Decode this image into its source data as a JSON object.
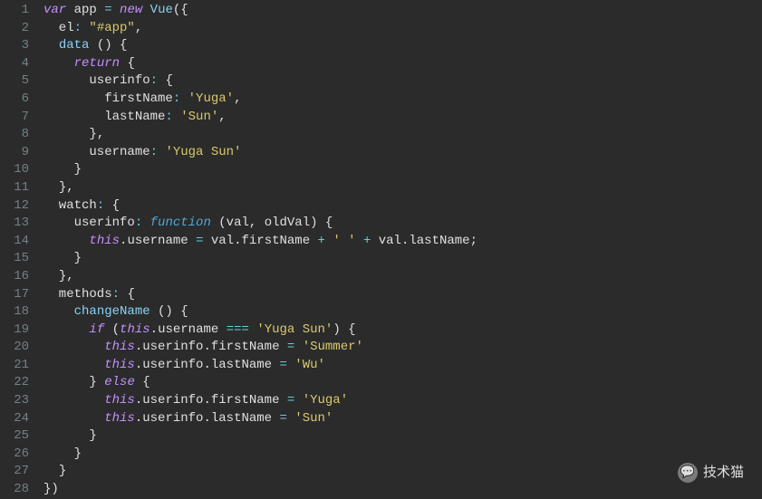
{
  "watermark": {
    "text": "技术猫",
    "icon": "💬"
  },
  "lines": {
    "count": 28,
    "tokens": [
      [
        [
          "kw",
          "var"
        ],
        [
          "id",
          " app "
        ],
        [
          "op",
          "="
        ],
        [
          "id",
          " "
        ],
        [
          "new",
          "new"
        ],
        [
          "id",
          " "
        ],
        [
          "def",
          "Vue"
        ],
        [
          "punc",
          "({"
        ]
      ],
      [
        [
          "id",
          "  el"
        ],
        [
          "op",
          ":"
        ],
        [
          "id",
          " "
        ],
        [
          "str",
          "\"#app\""
        ],
        [
          "punc",
          ","
        ]
      ],
      [
        [
          "id",
          "  "
        ],
        [
          "def",
          "data"
        ],
        [
          "id",
          " "
        ],
        [
          "punc",
          "() {"
        ]
      ],
      [
        [
          "id",
          "    "
        ],
        [
          "kw2",
          "return"
        ],
        [
          "id",
          " "
        ],
        [
          "punc",
          "{"
        ]
      ],
      [
        [
          "id",
          "      userinfo"
        ],
        [
          "op",
          ":"
        ],
        [
          "id",
          " "
        ],
        [
          "punc",
          "{"
        ]
      ],
      [
        [
          "id",
          "        firstName"
        ],
        [
          "op",
          ":"
        ],
        [
          "id",
          " "
        ],
        [
          "str",
          "'Yuga'"
        ],
        [
          "punc",
          ","
        ]
      ],
      [
        [
          "id",
          "        lastName"
        ],
        [
          "op",
          ":"
        ],
        [
          "id",
          " "
        ],
        [
          "str",
          "'Sun'"
        ],
        [
          "punc",
          ","
        ]
      ],
      [
        [
          "id",
          "      "
        ],
        [
          "punc",
          "},"
        ]
      ],
      [
        [
          "id",
          "      username"
        ],
        [
          "op",
          ":"
        ],
        [
          "id",
          " "
        ],
        [
          "str",
          "'Yuga Sun'"
        ]
      ],
      [
        [
          "id",
          "    "
        ],
        [
          "punc",
          "}"
        ]
      ],
      [
        [
          "id",
          "  "
        ],
        [
          "punc",
          "},"
        ]
      ],
      [
        [
          "id",
          "  watch"
        ],
        [
          "op",
          ":"
        ],
        [
          "id",
          " "
        ],
        [
          "punc",
          "{"
        ]
      ],
      [
        [
          "id",
          "    userinfo"
        ],
        [
          "op",
          ":"
        ],
        [
          "id",
          " "
        ],
        [
          "fn",
          "function"
        ],
        [
          "id",
          " "
        ],
        [
          "punc",
          "("
        ],
        [
          "id",
          "val"
        ],
        [
          "punc",
          ", "
        ],
        [
          "id",
          "oldVal"
        ],
        [
          "punc",
          ") {"
        ]
      ],
      [
        [
          "id",
          "      "
        ],
        [
          "this",
          "this"
        ],
        [
          "punc",
          "."
        ],
        [
          "id",
          "username "
        ],
        [
          "op",
          "="
        ],
        [
          "id",
          " val"
        ],
        [
          "punc",
          "."
        ],
        [
          "id",
          "firstName "
        ],
        [
          "op",
          "+"
        ],
        [
          "id",
          " "
        ],
        [
          "str",
          "' '"
        ],
        [
          "id",
          " "
        ],
        [
          "op",
          "+"
        ],
        [
          "id",
          " val"
        ],
        [
          "punc",
          "."
        ],
        [
          "id",
          "lastName"
        ],
        [
          "punc",
          ";"
        ]
      ],
      [
        [
          "id",
          "    "
        ],
        [
          "punc",
          "}"
        ]
      ],
      [
        [
          "id",
          "  "
        ],
        [
          "punc",
          "},"
        ]
      ],
      [
        [
          "id",
          "  methods"
        ],
        [
          "op",
          ":"
        ],
        [
          "id",
          " "
        ],
        [
          "punc",
          "{"
        ]
      ],
      [
        [
          "id",
          "    "
        ],
        [
          "def",
          "changeName"
        ],
        [
          "id",
          " "
        ],
        [
          "punc",
          "() {"
        ]
      ],
      [
        [
          "id",
          "      "
        ],
        [
          "kw2",
          "if"
        ],
        [
          "id",
          " "
        ],
        [
          "punc",
          "("
        ],
        [
          "this",
          "this"
        ],
        [
          "punc",
          "."
        ],
        [
          "id",
          "username "
        ],
        [
          "op",
          "==="
        ],
        [
          "id",
          " "
        ],
        [
          "str",
          "'Yuga Sun'"
        ],
        [
          "punc",
          ") {"
        ]
      ],
      [
        [
          "id",
          "        "
        ],
        [
          "this",
          "this"
        ],
        [
          "punc",
          "."
        ],
        [
          "id",
          "userinfo"
        ],
        [
          "punc",
          "."
        ],
        [
          "id",
          "firstName "
        ],
        [
          "op",
          "="
        ],
        [
          "id",
          " "
        ],
        [
          "str",
          "'Summer'"
        ]
      ],
      [
        [
          "id",
          "        "
        ],
        [
          "this",
          "this"
        ],
        [
          "punc",
          "."
        ],
        [
          "id",
          "userinfo"
        ],
        [
          "punc",
          "."
        ],
        [
          "id",
          "lastName "
        ],
        [
          "op",
          "="
        ],
        [
          "id",
          " "
        ],
        [
          "str",
          "'Wu'"
        ]
      ],
      [
        [
          "id",
          "      "
        ],
        [
          "punc",
          "} "
        ],
        [
          "kw2",
          "else"
        ],
        [
          "id",
          " "
        ],
        [
          "punc",
          "{"
        ]
      ],
      [
        [
          "id",
          "        "
        ],
        [
          "this",
          "this"
        ],
        [
          "punc",
          "."
        ],
        [
          "id",
          "userinfo"
        ],
        [
          "punc",
          "."
        ],
        [
          "id",
          "firstName "
        ],
        [
          "op",
          "="
        ],
        [
          "id",
          " "
        ],
        [
          "str",
          "'Yuga'"
        ]
      ],
      [
        [
          "id",
          "        "
        ],
        [
          "this",
          "this"
        ],
        [
          "punc",
          "."
        ],
        [
          "id",
          "userinfo"
        ],
        [
          "punc",
          "."
        ],
        [
          "id",
          "lastName "
        ],
        [
          "op",
          "="
        ],
        [
          "id",
          " "
        ],
        [
          "str",
          "'Sun'"
        ]
      ],
      [
        [
          "id",
          "      "
        ],
        [
          "punc",
          "}"
        ]
      ],
      [
        [
          "id",
          "    "
        ],
        [
          "punc",
          "}"
        ]
      ],
      [
        [
          "id",
          "  "
        ],
        [
          "punc",
          "}"
        ]
      ],
      [
        [
          "punc",
          "})"
        ]
      ]
    ]
  }
}
